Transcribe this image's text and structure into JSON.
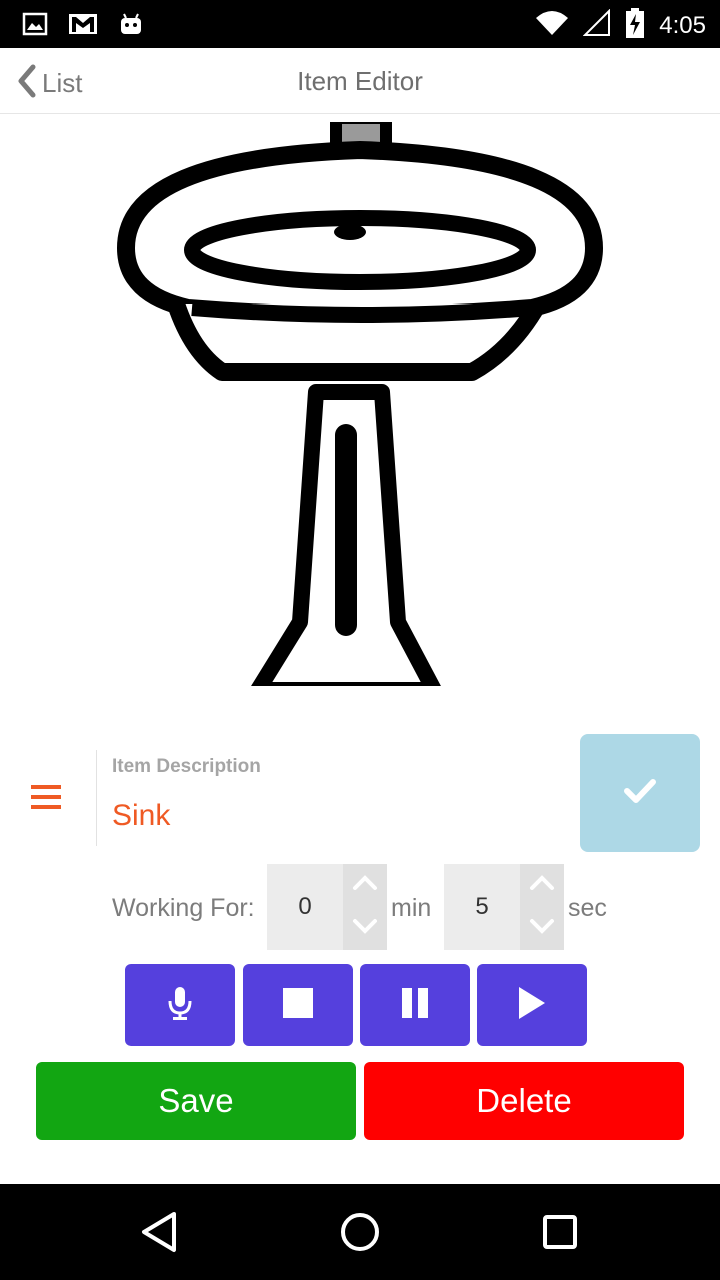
{
  "status_bar": {
    "time": "4:05",
    "icons": [
      "image-icon",
      "gmail-icon",
      "android-icon",
      "wifi-icon",
      "signal-icon",
      "battery-charging-icon"
    ]
  },
  "nav": {
    "back_label": "List",
    "title": "Item Editor"
  },
  "image": {
    "subject_icon": "sink-drawing"
  },
  "description": {
    "label": "Item Description",
    "value": "Sink"
  },
  "working_for": {
    "label": "Working For:",
    "minutes": "0",
    "minutes_unit": "min",
    "seconds": "5",
    "seconds_unit": "sec"
  },
  "media_controls": [
    "microphone-icon",
    "stop-icon",
    "pause-icon",
    "play-icon"
  ],
  "actions": {
    "save_label": "Save",
    "delete_label": "Delete"
  },
  "colors": {
    "accent_orange": "#ef5a24",
    "confirm_bg": "#add8e6",
    "media_purple": "#5540dd",
    "save_green": "#12a612",
    "delete_red": "#ff0000"
  }
}
